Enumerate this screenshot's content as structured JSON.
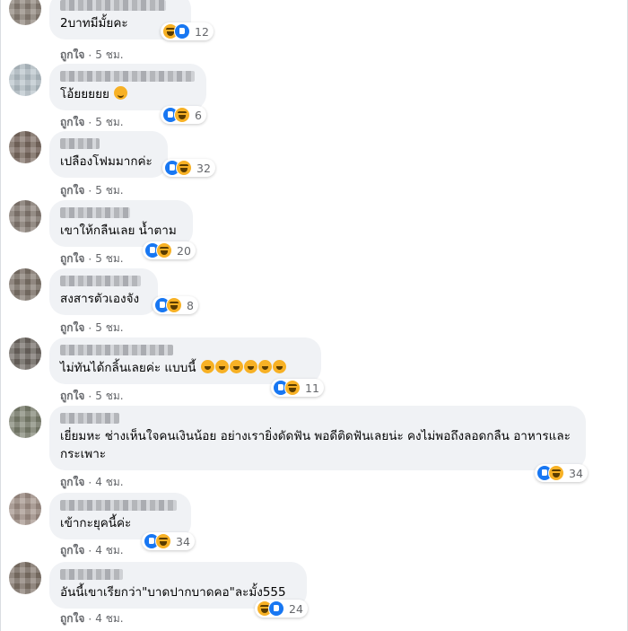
{
  "comments": [
    {
      "text": "2บาทมีมั้ยคะ",
      "like_label": "ถูกใจ",
      "time": "5 ชม.",
      "reaction_count": "12",
      "reactions": [
        "haha",
        "like"
      ]
    },
    {
      "text": "โอ้ยยยยย",
      "like_label": "ถูกใจ",
      "time": "5 ชม.",
      "reaction_count": "6",
      "reactions": [
        "like",
        "haha"
      ],
      "emoji": "grinning-smile-emoji"
    },
    {
      "text": "เปลืองโฟมมากค่ะ",
      "like_label": "ถูกใจ",
      "time": "5 ชม.",
      "reaction_count": "32",
      "reactions": [
        "like",
        "haha"
      ]
    },
    {
      "text": "เขาให้กลืนเลย น้ำตาม",
      "like_label": "ถูกใจ",
      "time": "5 ชม.",
      "reaction_count": "20",
      "reactions": [
        "like",
        "haha"
      ]
    },
    {
      "text": "สงสารตัวเองจัง",
      "like_label": "ถูกใจ",
      "time": "5 ชม.",
      "reaction_count": "8",
      "reactions": [
        "like",
        "haha"
      ]
    },
    {
      "text": "ไม่ทันได้กลิ้นเลยค่ะ แบบนี้",
      "like_label": "ถูกใจ",
      "time": "5 ชม.",
      "reaction_count": "11",
      "reactions": [
        "like",
        "haha"
      ],
      "emoji_count": 6,
      "emoji": "laughing-emoji"
    },
    {
      "text": "เยี่ยมหะ ช่างเห็นใจคนเงินน้อย อย่างเรายิ่งดัดฟัน พอดีติดฟันเลยน่ะ คงไม่พอถึงลอดกลืน อาหารและกระเพาะ",
      "like_label": "ถูกใจ",
      "time": "4 ชม.",
      "reaction_count": "34",
      "reactions": [
        "like",
        "haha"
      ]
    },
    {
      "text": "เข้ากะยุคนี้ค่ะ",
      "like_label": "ถูกใจ",
      "time": "4 ชม.",
      "reaction_count": "34",
      "reactions": [
        "like",
        "haha"
      ]
    },
    {
      "text": "อันนี้เขาเรียกว่า\"บาดปากบาดคอ\"ละมั้ง555",
      "like_label": "ถูกใจ",
      "time": "4 ชม.",
      "reaction_count": "24",
      "reactions": [
        "haha",
        "like"
      ]
    }
  ],
  "colors": {
    "bubble": "#f0f2f5",
    "like_blue": "#1877f2",
    "haha_yellow": "#f7b125",
    "meta_gray": "#65676b"
  }
}
